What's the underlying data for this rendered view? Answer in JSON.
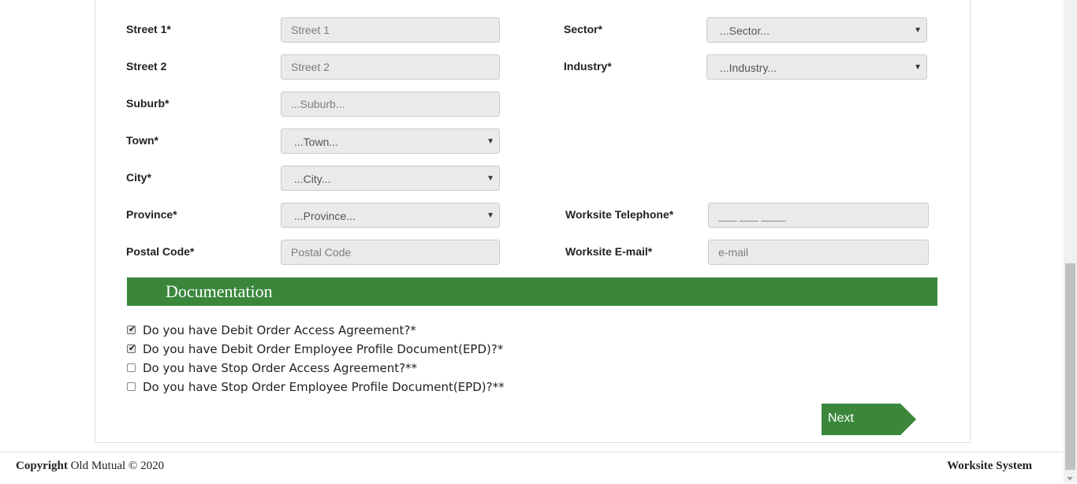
{
  "form": {
    "street1": {
      "label": "Street 1*",
      "placeholder": "Street 1"
    },
    "street2": {
      "label": "Street 2",
      "placeholder": "Street 2"
    },
    "suburb": {
      "label": "Suburb*",
      "placeholder": "...Suburb..."
    },
    "town": {
      "label": "Town*",
      "value": "...Town..."
    },
    "city": {
      "label": "City*",
      "value": "...City..."
    },
    "province": {
      "label": "Province*",
      "value": "...Province..."
    },
    "postal_code": {
      "label": "Postal Code*",
      "placeholder": "Postal Code"
    },
    "sector": {
      "label": "Sector*",
      "value": "...Sector..."
    },
    "industry": {
      "label": "Industry*",
      "value": "...Industry..."
    },
    "telephone": {
      "label": "Worksite Telephone*",
      "placeholder": "___ ___ ____"
    },
    "email": {
      "label": "Worksite E-mail*",
      "placeholder": "e-mail"
    }
  },
  "documentation": {
    "title": "Documentation",
    "items": [
      {
        "label": "Do you have Debit Order Access Agreement?*",
        "checked": true
      },
      {
        "label": "Do you have Debit Order Employee Profile Document(EPD)?*",
        "checked": true
      },
      {
        "label": "Do you have Stop Order Access Agreement?**",
        "checked": false
      },
      {
        "label": "Do you have Stop Order Employee Profile Document(EPD)?**",
        "checked": false
      }
    ]
  },
  "actions": {
    "next_label": "Next"
  },
  "footer": {
    "copyright_bold": "Copyright",
    "copyright_rest": "Old Mutual © 2020",
    "system_name": "Worksite System"
  },
  "colors": {
    "accent_green": "#3a873c"
  }
}
